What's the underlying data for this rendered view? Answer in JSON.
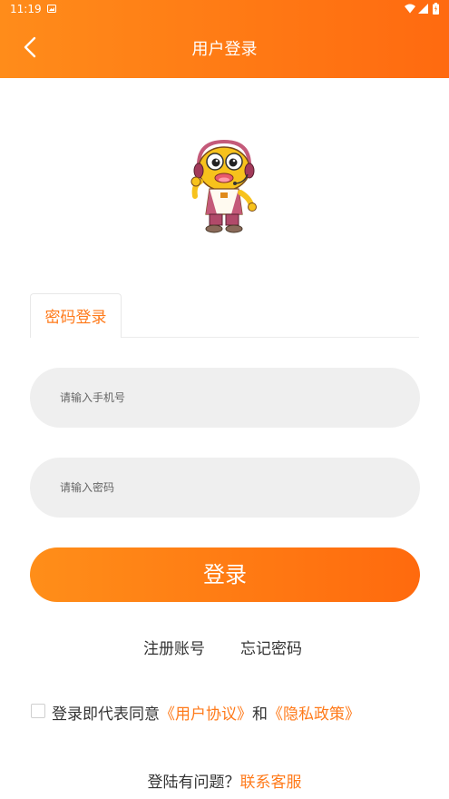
{
  "status_bar": {
    "time": "11:19"
  },
  "header": {
    "title": "用户登录"
  },
  "tabs": [
    {
      "label": "密码登录",
      "active": true
    }
  ],
  "form": {
    "phone": {
      "value": "",
      "placeholder": "请输入手机号"
    },
    "password": {
      "value": "",
      "placeholder": "请输入密码"
    },
    "login_label": "登录"
  },
  "links": {
    "register": "注册账号",
    "forgot": "忘记密码"
  },
  "agreement": {
    "checked": false,
    "prefix": "登录即代表同意",
    "user_agreement": "《用户协议》",
    "and": "和",
    "privacy_policy": "《隐私政策》"
  },
  "help": {
    "question": "登陆有问题？",
    "contact": "联系客服"
  },
  "colors": {
    "accent": "#ff7a1a",
    "gradient_start": "#ff8c1a",
    "gradient_end": "#ff6a10",
    "input_bg": "#efefef"
  },
  "icons": [
    "back-icon",
    "notification-icon",
    "wifi-icon",
    "signal-icon",
    "battery-icon",
    "mascot-image"
  ]
}
